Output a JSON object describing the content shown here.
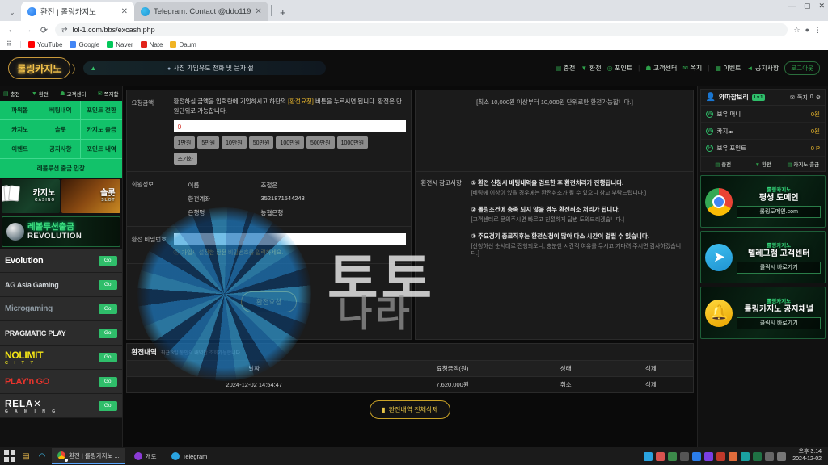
{
  "browser": {
    "tabs": [
      {
        "title": "환전 | 롤링카지노",
        "close": "✕",
        "favicon": "site-favicon"
      },
      {
        "title": "Telegram: Contact @ddo119",
        "close": "✕",
        "favicon": "telegram-favicon"
      }
    ],
    "new_tab": "+",
    "tab_search": "⌄",
    "back": "←",
    "forward": "→",
    "reload": "⟳",
    "site_info_icon": "⇄",
    "url": "lol-1.com/bbs/excash.php",
    "star": "☆",
    "profile": "●",
    "menu": "⋮",
    "window": {
      "minimize": "—",
      "maximize": "▢",
      "close": "✕"
    },
    "bookmarks": [
      {
        "label": "YouTube",
        "color": "#ff0000"
      },
      {
        "label": "Google",
        "color": "#4285f4"
      },
      {
        "label": "Naver",
        "color": "#03c75a"
      },
      {
        "label": "Nate",
        "color": "#e2231a"
      },
      {
        "label": "Daum",
        "color": "#f0b323"
      }
    ],
    "apps_icon": "⠿"
  },
  "site": {
    "logo": "롤링카지노",
    "notice": "사칭 가입유도 전화 및 문자 절",
    "topnav": [
      {
        "label": "충전",
        "icon": "deposit-icon"
      },
      {
        "label": "환전",
        "icon": "withdraw-icon"
      },
      {
        "label": "포인트",
        "icon": "point-icon"
      },
      {
        "label": "고객센터",
        "icon": "support-icon"
      },
      {
        "label": "쪽지",
        "icon": "message-icon"
      },
      {
        "label": "이벤트",
        "icon": "event-icon"
      },
      {
        "label": "공지사항",
        "icon": "notice-icon"
      }
    ],
    "logout": "로그아웃"
  },
  "sidebar": {
    "top_items": [
      {
        "label": "충전",
        "icon": "deposit-icon"
      },
      {
        "label": "환전",
        "icon": "withdraw-icon"
      },
      {
        "label": "고객센터",
        "icon": "support-icon"
      },
      {
        "label": "쪽지함",
        "icon": "message-icon"
      }
    ],
    "menu_grid": [
      "파워볼",
      "베팅내역",
      "포인트 전환",
      "카지노",
      "슬롯",
      "카지노 출금",
      "이벤트",
      "공지사항",
      "포인트 내역"
    ],
    "menu_wide": "레볼루션 출금 입장",
    "banners": [
      {
        "title": "카지노",
        "sub": "CASINO"
      },
      {
        "title": "슬롯",
        "sub": "SLOT"
      }
    ],
    "revolution": {
      "kr": "레볼루션출금",
      "en": "REVOLUTION",
      "brand": "Revolution"
    },
    "providers": [
      {
        "name": "Evolution",
        "go": "Go"
      },
      {
        "name": "AG Asia Gaming",
        "go": "Go"
      },
      {
        "name": "Microgaming",
        "go": "Go"
      },
      {
        "name": "PRAGMATIC PLAY",
        "go": "Go"
      },
      {
        "name": "NOLIMIT",
        "name2": "C I T Y",
        "go": "Go"
      },
      {
        "name": "PLAY'n GO",
        "go": "Go"
      },
      {
        "name": "RELA✕",
        "name2": "G A M I N G",
        "go": "Go"
      }
    ]
  },
  "form": {
    "amount_label": "요청금액",
    "amount_desc_1": "환전하실 금액을 입력란에 기입하시고 하단의 ",
    "amount_desc_hl": "[환전요청]",
    "amount_desc_2": " 버튼을 누르시면 됩니다. 환전은 만원단위로 가능합니다.",
    "amount_value": "0",
    "chips": [
      "1만원",
      "5만원",
      "10만원",
      "50만원",
      "100만원",
      "500만원",
      "1000만원"
    ],
    "reset": "초기화",
    "member_label": "회원정보",
    "member_rows": [
      {
        "key": "이름",
        "value": "조철운"
      },
      {
        "key": "환전계좌",
        "value": "3521871544243"
      },
      {
        "key": "은행명",
        "value": "농협은행"
      }
    ],
    "password_label": "환전 비밀번호",
    "password_value": "",
    "password_hint": "가입시 설정한 환전 비밀번호를 입력하세요.",
    "hint_icon": "ⓘ",
    "submit": "환전요청",
    "min_note": "[최소 10,000원 이상부터 10,000원 단위로만 환전가능합니다.]",
    "notes_label": "환전시 참고사항",
    "notes": [
      {
        "num": "①",
        "title": "환전 신청시 베팅내역을 검토한 후 환전처리가 진행됩니다.",
        "sub": "[베팅에 이상이 있을 경우에는 환전취소가 될 수 있으니 참고 부탁드립니다.]"
      },
      {
        "num": "②",
        "title": "롤링조건에 충족 되지 않을 경우 환전취소 처리가 됩니다.",
        "sub": "[고객센터로 문의주시면 빠르고 친절하게 답변 도와드리겠습니다.]"
      },
      {
        "num": "③",
        "title": "주요경기 종료직후는 환전신청이 많아 다소 시간이 걸릴 수 있습니다.",
        "sub": "[신청하신 순서대로 진행되오니, 충분한 시간적 여유를 두시고 기다려 주시면 감사하겠습니다.]"
      }
    ]
  },
  "history": {
    "title": "환전내역",
    "subtitle": "최근 3일 동안의 내역만 조회가능합니다",
    "columns": [
      "날짜",
      "요청금액(원)",
      "상태",
      "삭제"
    ],
    "rows": [
      {
        "date": "2024-12-02 14:54:47",
        "amount": "7,620,000원",
        "status": "취소",
        "delete": "삭제"
      }
    ],
    "delete_all": "환전내역 전체삭제",
    "delete_all_icon": "trash-icon"
  },
  "account": {
    "name": "와따잡보리",
    "level": "Lv.1",
    "message_label": "쪽지",
    "message_count": "0",
    "settings_icon": "gear-icon",
    "balances": [
      {
        "icon": "won-icon",
        "key": "보유 머니",
        "value": "0원"
      },
      {
        "icon": "won-icon",
        "key": "카지노",
        "value": "0원"
      },
      {
        "icon": "point-icon",
        "key": "보유 포인트",
        "value": "0 P"
      }
    ],
    "actions": [
      {
        "label": "충전",
        "icon": "deposit-icon"
      },
      {
        "label": "환전",
        "icon": "withdraw-icon"
      },
      {
        "label": "카지노 출금",
        "icon": "casino-withdraw-icon"
      }
    ]
  },
  "promos": [
    {
      "icon": "chrome-icon",
      "brand": "롤링카지노",
      "title": "평생 도메인",
      "cta": "롤링도메인.com"
    },
    {
      "icon": "telegram-icon",
      "brand": "롤링카지노",
      "title": "텔레그램 고객센터",
      "cta": "클릭시 바로가기"
    },
    {
      "icon": "bell-icon",
      "brand": "롤링카지노",
      "title": "롤링카지노 공지채널",
      "cta": "클릭시 바로가기"
    }
  ],
  "taskbar": {
    "start": "start-icon",
    "pinned": [
      {
        "name": "file-explorer-icon",
        "glyph": "🗂",
        "color": "#f2c14e"
      },
      {
        "name": "edge-icon",
        "glyph": "◠",
        "color": "#3fb9e8"
      }
    ],
    "tasks": [
      {
        "label": "환전 | 롤링카지노 ...",
        "icon": "chrome-icon",
        "active": true
      },
      {
        "label": "개도",
        "icon": "app-icon",
        "active": false
      },
      {
        "label": "Telegram",
        "icon": "telegram-icon",
        "active": false
      }
    ],
    "tray_icons": [
      "telegram-tray",
      "download-tray",
      "green-tray",
      "moon-tray",
      "blue-tray",
      "purple-tray",
      "red-tray",
      "orange-tray",
      "teal-tray",
      "excel-tray",
      "network-tray",
      "volume-tray"
    ],
    "time": "오후 3:14",
    "date": "2024-12-02"
  }
}
